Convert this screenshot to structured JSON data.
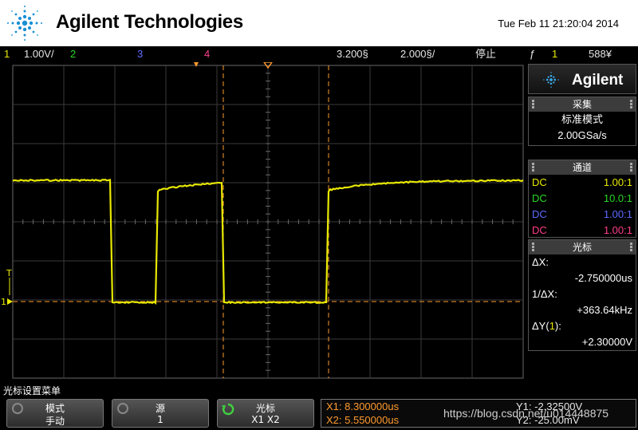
{
  "header": {
    "brand": "Agilent Technologies",
    "datetime": "Tue Feb 11 21:20:04 2014"
  },
  "status": {
    "ch1_num": "1",
    "ch1_scale": "1.00V/",
    "ch2_num": "2",
    "ch3_num": "3",
    "ch4_num": "4",
    "time_delay": "3.200§",
    "time_scale": "2.000§/",
    "run_state": "停止",
    "trigger_icon": "ƒ",
    "trigger_source": "1",
    "trigger_level": "588¥"
  },
  "side_panel": {
    "logo_text": "Agilent",
    "acquire": {
      "title": "采集",
      "mode": "标准模式",
      "rate": "2.00GSa/s"
    },
    "channels": {
      "title": "通道",
      "rows": [
        {
          "coupling": "DC",
          "probe": "1.00:1",
          "color": "#e8e800"
        },
        {
          "coupling": "DC",
          "probe": "10.0:1",
          "color": "#27d827"
        },
        {
          "coupling": "DC",
          "probe": "1.00:1",
          "color": "#5c6cff"
        },
        {
          "coupling": "DC",
          "probe": "1.00:1",
          "color": "#ff3e8a"
        }
      ]
    },
    "cursors": {
      "title": "光标",
      "dx_label": "ΔX:",
      "dx_value": "-2.750000us",
      "inv_dx_label": "1/ΔX:",
      "inv_dx_value": "+363.64kHz",
      "dy_label_pre": "ΔY(",
      "dy_label_ch": "1",
      "dy_label_post": "):",
      "dy_value": "+2.30000V"
    }
  },
  "menu": {
    "title": "光标设置菜单",
    "softkeys": [
      {
        "label": "模式",
        "value": "手动"
      },
      {
        "label": "源",
        "value": "1"
      },
      {
        "label": "光标",
        "value": "X1 X2"
      }
    ],
    "readout": {
      "x1": "X1: 8.300000us",
      "x2": "X2: 5.550000us",
      "y1": "Y1: -2.32500V",
      "y2": "Y2: -25.00mV"
    }
  },
  "waveform": {
    "channel": "1",
    "color": "#e8e800",
    "cursor_color": "#ff9a2e",
    "ground_marker": "1",
    "trigger_marker": "T",
    "high_level_div": 1.0,
    "low_level_div": -2.0
  },
  "watermark": "https://blog.csdn.net/u014448875"
}
